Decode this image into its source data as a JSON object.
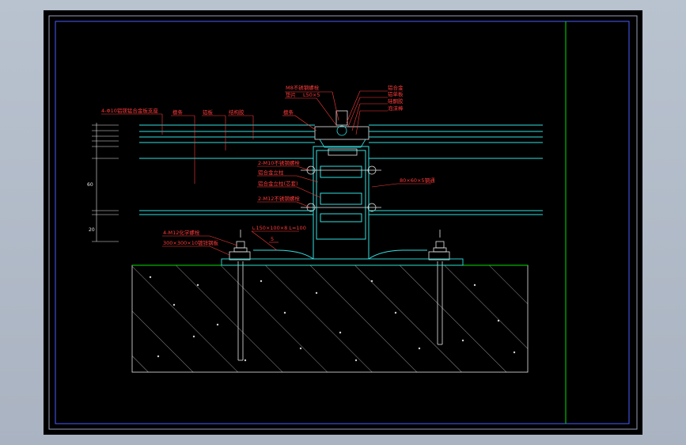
{
  "drawing": {
    "labels": {
      "left_top": "4-Φ10铝镁锰合金板支座",
      "roof_1": "檩条",
      "roof_2": "檩条",
      "roof_3": "铝板",
      "roof_4": "结构胶",
      "top_left_1": "M8不锈钢螺栓",
      "top_left_2": "垫片",
      "top_left_3": "L50×5",
      "top_left_4": "螺栓",
      "top_right_1": "铝合金",
      "top_right_2": "铝单板",
      "top_right_3": "硅酮胶",
      "top_right_4": "泡沫棒",
      "mid_1": "2-M10不锈钢螺栓",
      "mid_2": "铝合金立柱",
      "mid_3": "铝合金立柱(芯套)",
      "mid_4": "2-M12不锈钢螺栓",
      "right_beam": "80×60×5钢通",
      "base_1": "4-M12化学螺栓",
      "base_2": "300×300×10镀锌钢板",
      "base_3": "∟150×100×8  L=100",
      "base_4": "5",
      "dim_1": "60",
      "dim_2": "20"
    },
    "colors": {
      "background": "#000000",
      "frame": "#9aa0b8",
      "cyan": "#32e0e0",
      "red": "#ff3b3b",
      "white": "#e8e8e8",
      "green": "#00e000"
    }
  }
}
